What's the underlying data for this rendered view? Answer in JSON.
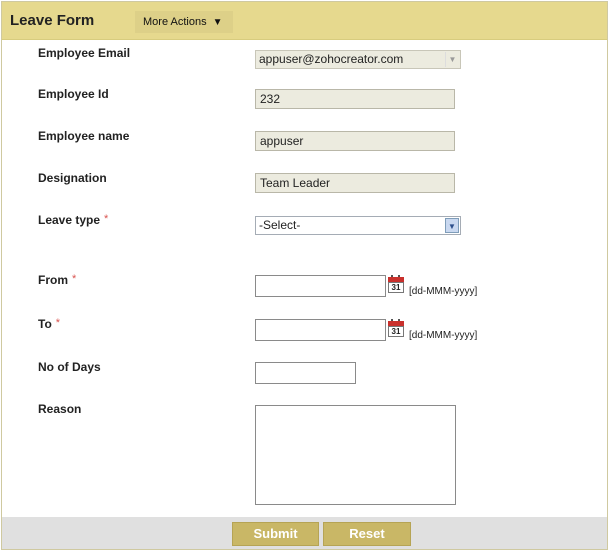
{
  "header": {
    "title": "Leave Form",
    "more_actions": "More Actions",
    "more_actions_arrow": "▼"
  },
  "fields": {
    "email": {
      "label": "Employee Email",
      "value": "appuser@zohocreator.com"
    },
    "employee_id": {
      "label": "Employee Id",
      "value": "232"
    },
    "employee_name": {
      "label": "Employee name",
      "value": "appuser"
    },
    "designation": {
      "label": "Designation",
      "value": "Team Leader"
    },
    "leave_type": {
      "label": "Leave type",
      "value": "-Select-"
    },
    "from": {
      "label": "From",
      "value": "",
      "format": "[dd-MMM-yyyy]"
    },
    "to": {
      "label": "To",
      "value": "",
      "format": "[dd-MMM-yyyy]"
    },
    "no_of_days": {
      "label": "No of Days",
      "value": ""
    },
    "reason": {
      "label": "Reason",
      "value": ""
    }
  },
  "required_marker": "*",
  "calendar_day": "31",
  "buttons": {
    "submit": "Submit",
    "reset": "Reset"
  },
  "colors": {
    "header": "#e6d98e",
    "button": "#c9b766",
    "required": "#d9534f",
    "footer": "#e0e0e0"
  }
}
